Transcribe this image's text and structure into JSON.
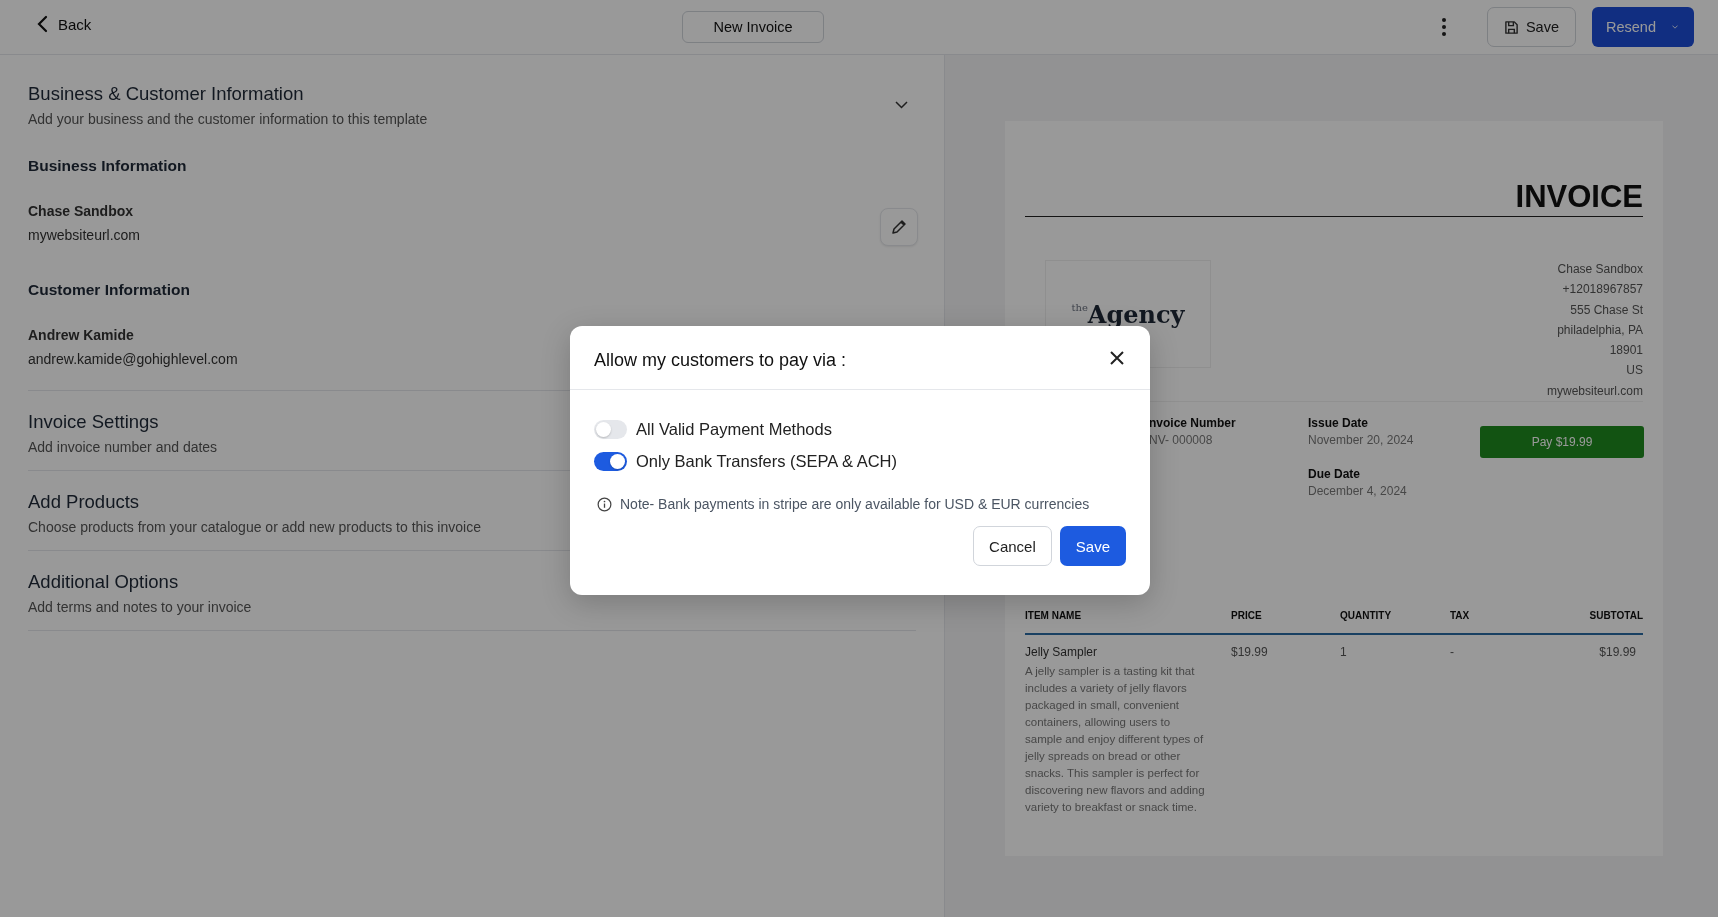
{
  "top_bar": {
    "back": "Back",
    "title": "New Invoice",
    "save": "Save",
    "resend": "Resend"
  },
  "sections": [
    {
      "title": "Business & Customer Information",
      "subtitle": "Add your business and the customer information to this template",
      "groups": [
        {
          "heading": "Business Information",
          "name": "Chase Sandbox",
          "detail": "mywebsiteurl.com",
          "editable": true
        },
        {
          "heading": "Customer Information",
          "name": "Andrew Kamide",
          "detail": "andrew.kamide@gohighlevel.com"
        }
      ]
    },
    {
      "title": "Invoice Settings",
      "subtitle": "Add invoice number and dates"
    },
    {
      "title": "Add Products",
      "subtitle": "Choose products from your catalogue or add new products to this invoice"
    },
    {
      "title": "Additional Options",
      "subtitle": "Add terms and notes to your invoice"
    }
  ],
  "invoice_preview": {
    "heading": "INVOICE",
    "logo_small": "the",
    "logo_large": "Agency",
    "address": [
      "Chase Sandbox",
      "+12018967857",
      "555 Chase St",
      "philadelphia, PA",
      "18901",
      "US",
      "mywebsiteurl.com"
    ],
    "meta": [
      {
        "label": "nvoice Number",
        "value": "NV- 000008"
      },
      {
        "label": "Issue Date",
        "value": "November 20, 2024"
      },
      {
        "label": "Due Date",
        "value": "December 4, 2024"
      }
    ],
    "pay_button": "Pay $19.99",
    "table": {
      "columns": [
        "ITEM NAME",
        "PRICE",
        "QUANTITY",
        "TAX",
        "SUBTOTAL"
      ],
      "rows": [
        {
          "name": "Jelly Sampler",
          "description": "A jelly sampler is a tasting kit that includes a variety of jelly flavors packaged in small, convenient containers, allowing users to sample and enjoy different types of jelly spreads on bread or other snacks. This sampler is perfect for discovering new flavors and adding variety to breakfast or snack time.",
          "price": "$19.99",
          "quantity": "1",
          "tax": "-",
          "subtotal": "$19.99"
        }
      ]
    }
  },
  "modal": {
    "title": "Allow my customers to pay via :",
    "options": [
      {
        "label": "All Valid Payment Methods",
        "on": false
      },
      {
        "label": "Only Bank Transfers (SEPA & ACH)",
        "on": true
      }
    ],
    "note": "Note- Bank payments in stripe are only available for USD & EUR currencies",
    "buttons": [
      {
        "label": "Cancel",
        "kind": "secondary"
      },
      {
        "label": "Save",
        "kind": "primary"
      }
    ]
  }
}
